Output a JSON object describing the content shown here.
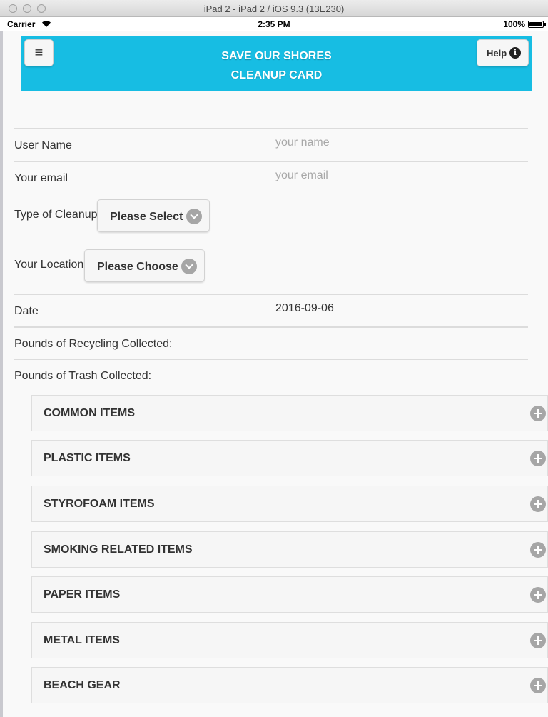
{
  "window": {
    "title": "iPad 2 - iPad 2 / iOS 9.3 (13E230)"
  },
  "status_bar": {
    "carrier": "Carrier",
    "time": "2:35 PM",
    "battery": "100%"
  },
  "header": {
    "title_line1": "SAVE OUR SHORES",
    "title_line2": "CLEANUP CARD",
    "menu_icon": "hamburger-icon",
    "help_label": "Help",
    "accent_color": "#17bde3"
  },
  "form": {
    "user_name": {
      "label": "User Name",
      "placeholder": "your name"
    },
    "email": {
      "label": "Your email",
      "placeholder": "your email"
    },
    "cleanup_type": {
      "label": "Type of Cleanup",
      "selected": "Please Select"
    },
    "location": {
      "label": "Your Location",
      "selected": "Please Choose"
    },
    "date": {
      "label": "Date",
      "value": "2016-09-06"
    },
    "recycling": {
      "label": "Pounds of Recycling Collected:"
    },
    "trash": {
      "label": "Pounds of Trash Collected:"
    }
  },
  "categories": [
    {
      "label": "COMMON ITEMS"
    },
    {
      "label": "PLASTIC ITEMS"
    },
    {
      "label": "STYROFOAM ITEMS"
    },
    {
      "label": "SMOKING RELATED ITEMS"
    },
    {
      "label": "PAPER ITEMS"
    },
    {
      "label": "METAL ITEMS"
    },
    {
      "label": "BEACH GEAR"
    }
  ]
}
